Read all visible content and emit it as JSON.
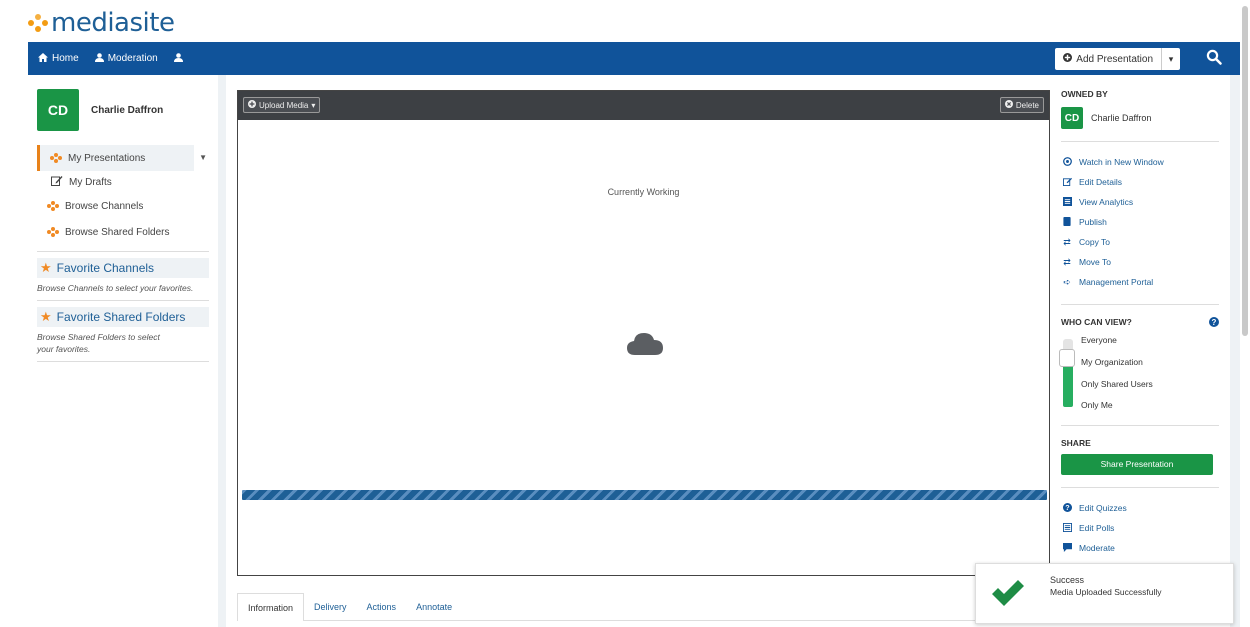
{
  "brand": {
    "logo_text": "mediasite",
    "primary": "#10539a",
    "accent": "#f08a24",
    "green": "#1a9546"
  },
  "nav": {
    "home": "Home",
    "moderation": "Moderation",
    "add_presentation": "Add Presentation"
  },
  "sidebar": {
    "user_initials": "CD",
    "user_name": "Charlie Daffron",
    "items": [
      {
        "label": "My Presentations"
      },
      {
        "label": "My Drafts"
      },
      {
        "label": "Browse Channels"
      },
      {
        "label": "Browse Shared Folders"
      }
    ],
    "fav_channels_title": "Favorite Channels",
    "fav_channels_note": "Browse Channels to select your favorites.",
    "fav_folders_title": "Favorite Shared Folders",
    "fav_folders_note": "Browse Shared Folders to select your favorites."
  },
  "player": {
    "upload_label": "Upload Media",
    "delete_label": "Delete",
    "status_text": "Currently Working",
    "progress": 1.0
  },
  "tabs": [
    "Information",
    "Delivery",
    "Actions",
    "Annotate"
  ],
  "right": {
    "owned_by_title": "OWNED BY",
    "owner_initials": "CD",
    "owner_name": "Charlie Daffron",
    "actions": [
      {
        "label": "Watch in New Window",
        "icon": "play-circle-icon"
      },
      {
        "label": "Edit Details",
        "icon": "edit-icon"
      },
      {
        "label": "View Analytics",
        "icon": "analytics-icon"
      },
      {
        "label": "Publish",
        "icon": "publish-icon"
      },
      {
        "label": "Copy To",
        "icon": "copy-icon"
      },
      {
        "label": "Move To",
        "icon": "move-icon"
      },
      {
        "label": "Management Portal",
        "icon": "portal-icon"
      }
    ],
    "who_can_view_title": "WHO CAN VIEW?",
    "visibility_levels": [
      "Everyone",
      "My Organization",
      "Only Shared Users",
      "Only Me"
    ],
    "selected_visibility": "My Organization",
    "share_title": "SHARE",
    "share_button": "Share Presentation",
    "extra_actions": [
      {
        "label": "Edit Quizzes",
        "icon": "quiz-icon"
      },
      {
        "label": "Edit Polls",
        "icon": "poll-icon"
      },
      {
        "label": "Moderate",
        "icon": "comment-icon"
      }
    ]
  },
  "toast": {
    "title": "Success",
    "message": "Media Uploaded Successfully"
  }
}
